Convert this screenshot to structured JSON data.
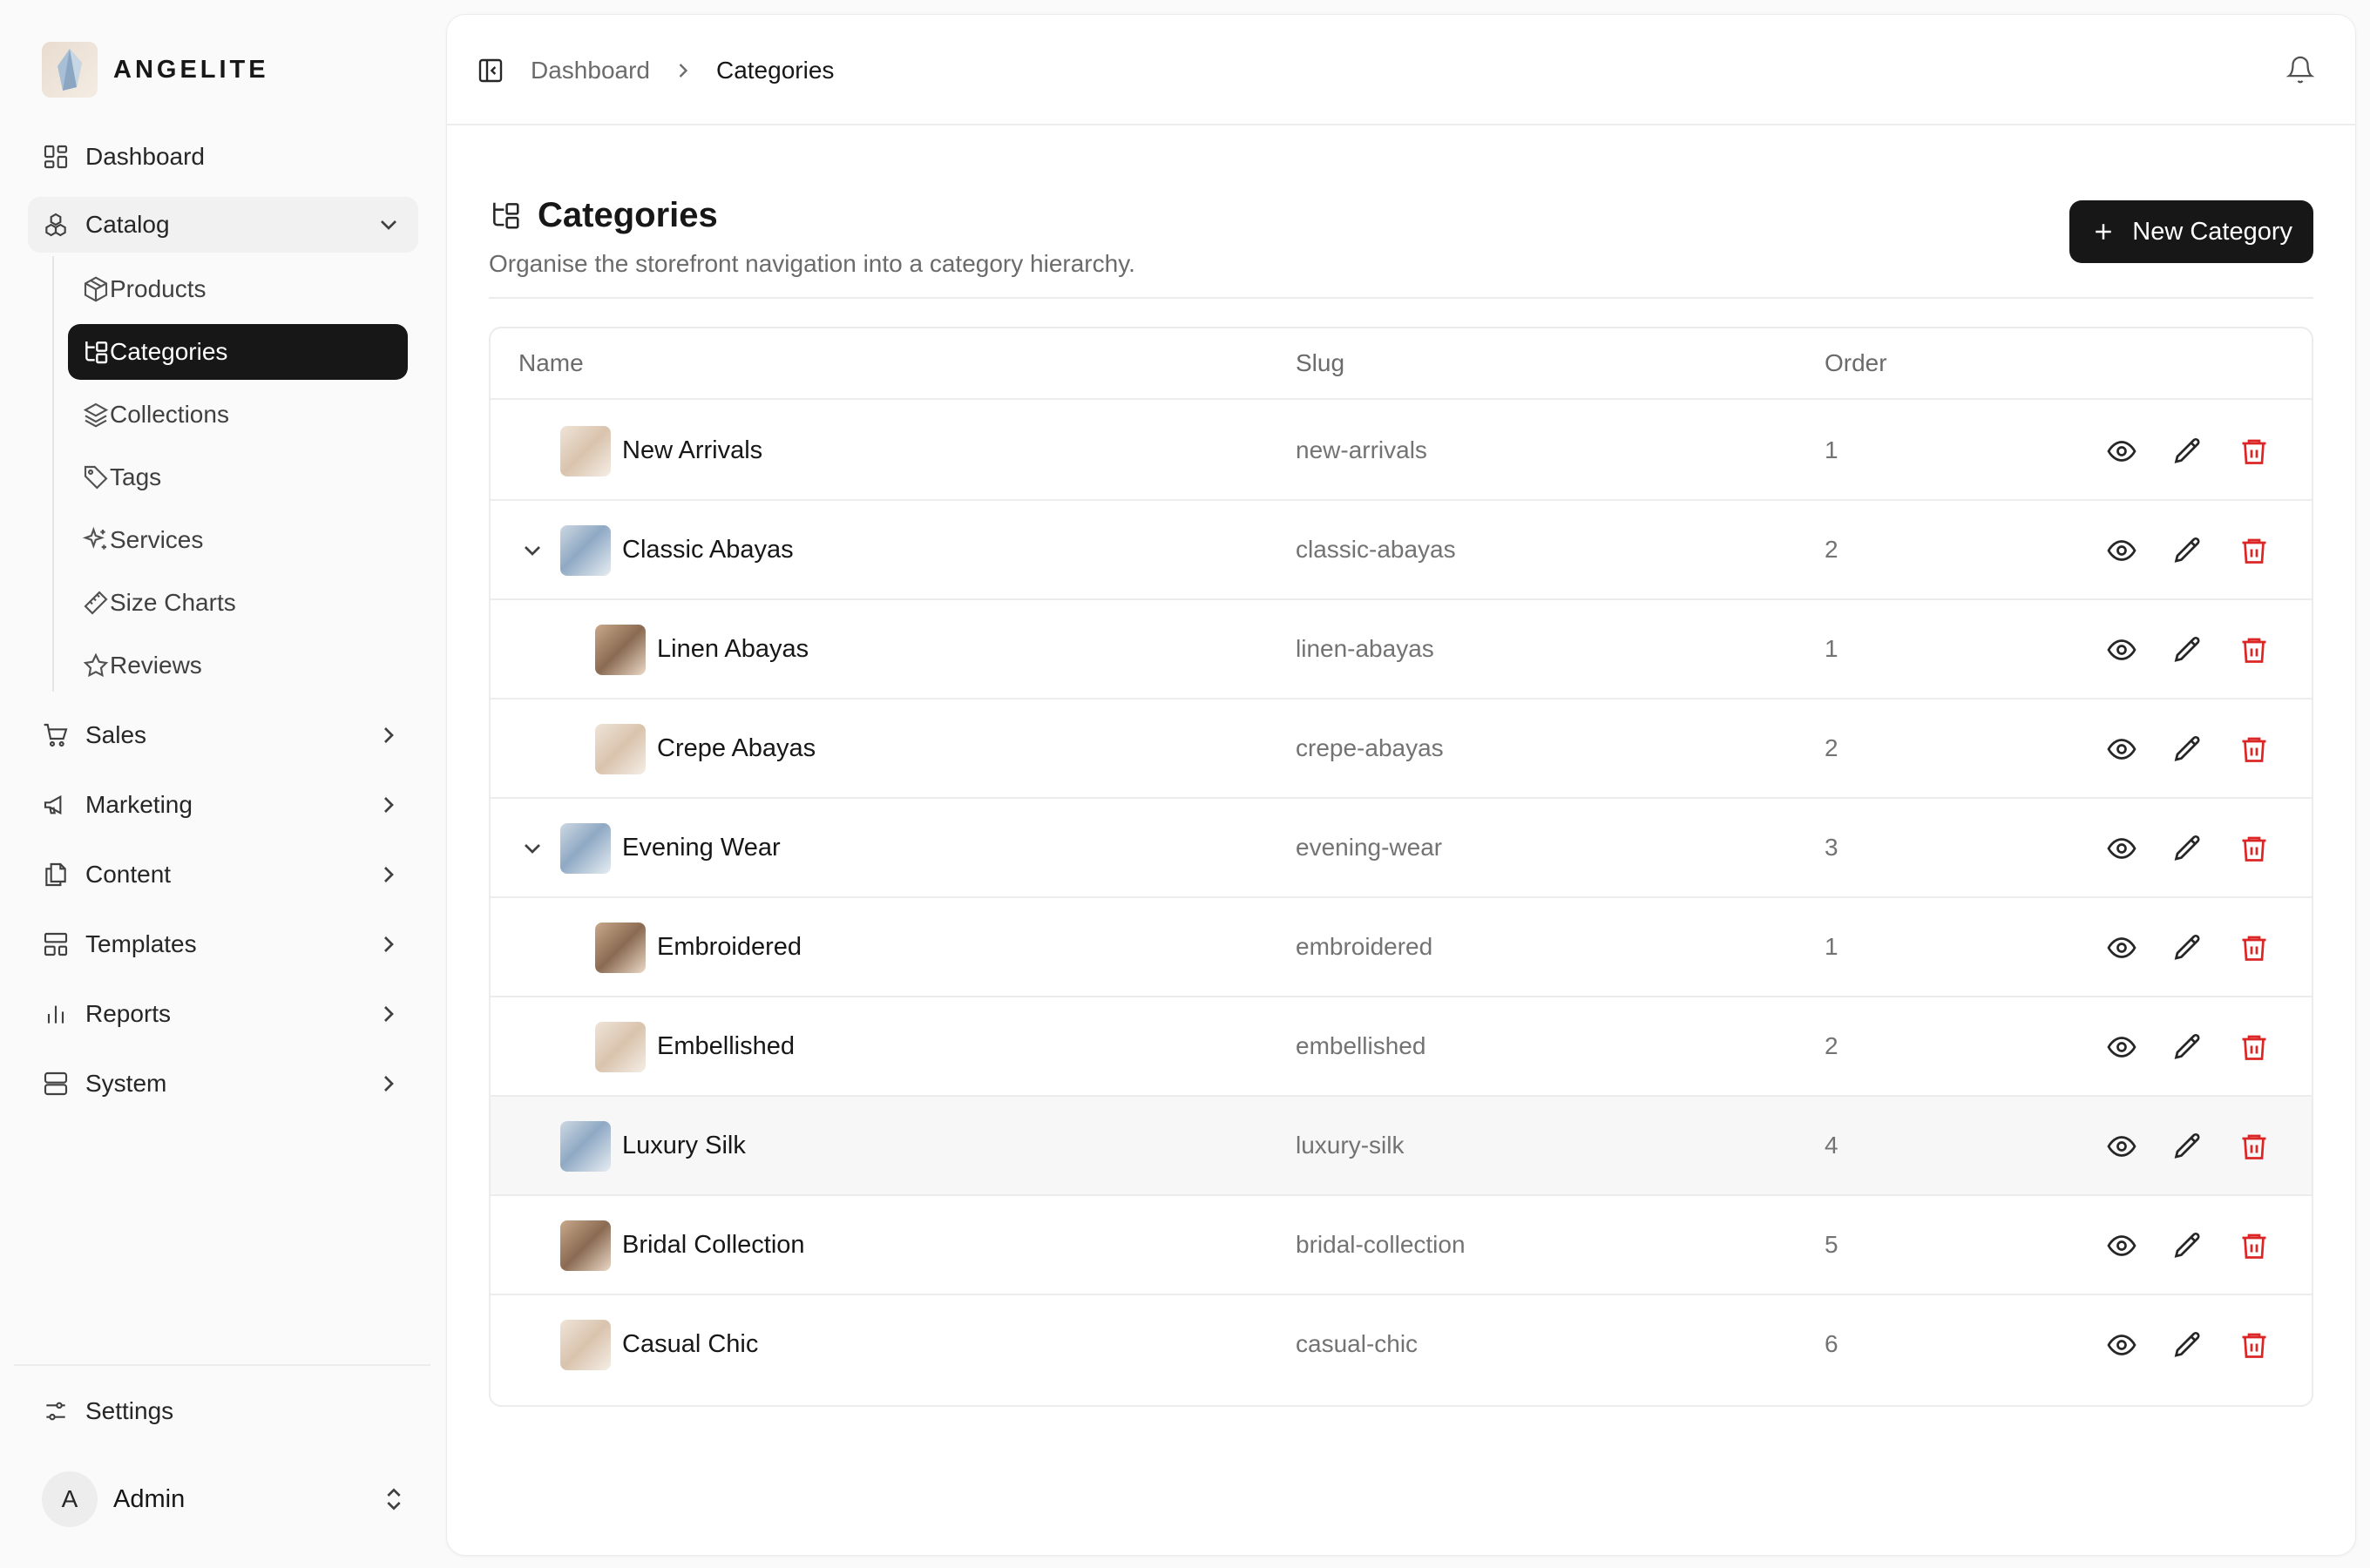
{
  "brand": {
    "name": "ANGELITE",
    "logo_icon": "crystal-logo"
  },
  "nav": {
    "dashboard": "Dashboard",
    "catalog": "Catalog",
    "catalog_items": {
      "products": "Products",
      "categories": "Categories",
      "collections": "Collections",
      "tags": "Tags",
      "services": "Services",
      "size_charts": "Size Charts",
      "reviews": "Reviews"
    },
    "sales": "Sales",
    "marketing": "Marketing",
    "content": "Content",
    "templates": "Templates",
    "reports": "Reports",
    "system": "System",
    "settings": "Settings"
  },
  "user": {
    "initial": "A",
    "name": "Admin"
  },
  "breadcrumb": {
    "parent": "Dashboard",
    "current": "Categories"
  },
  "page": {
    "title": "Categories",
    "subtitle": "Organise the storefront navigation into a category hierarchy.",
    "new_button": "New Category"
  },
  "table": {
    "columns": {
      "name": "Name",
      "slug": "Slug",
      "order": "Order"
    },
    "rows": [
      {
        "name": "New Arrivals",
        "slug": "new-arrivals",
        "order": "1",
        "level": 0,
        "expandable": false,
        "thumb": "beige"
      },
      {
        "name": "Classic Abayas",
        "slug": "classic-abayas",
        "order": "2",
        "level": 0,
        "expandable": true,
        "thumb": "blue"
      },
      {
        "name": "Linen Abayas",
        "slug": "linen-abayas",
        "order": "1",
        "level": 1,
        "expandable": false,
        "thumb": "room"
      },
      {
        "name": "Crepe Abayas",
        "slug": "crepe-abayas",
        "order": "2",
        "level": 1,
        "expandable": false,
        "thumb": "beige"
      },
      {
        "name": "Evening Wear",
        "slug": "evening-wear",
        "order": "3",
        "level": 0,
        "expandable": true,
        "thumb": "blue"
      },
      {
        "name": "Embroidered",
        "slug": "embroidered",
        "order": "1",
        "level": 1,
        "expandable": false,
        "thumb": "room"
      },
      {
        "name": "Embellished",
        "slug": "embellished",
        "order": "2",
        "level": 1,
        "expandable": false,
        "thumb": "beige"
      },
      {
        "name": "Luxury Silk",
        "slug": "luxury-silk",
        "order": "4",
        "level": 0,
        "expandable": false,
        "thumb": "blue",
        "highlighted": true
      },
      {
        "name": "Bridal Collection",
        "slug": "bridal-collection",
        "order": "5",
        "level": 0,
        "expandable": false,
        "thumb": "room"
      },
      {
        "name": "Casual Chic",
        "slug": "casual-chic",
        "order": "6",
        "level": 0,
        "expandable": false,
        "thumb": "beige"
      }
    ]
  },
  "colors": {
    "primary": "#171717",
    "danger": "#dc2626",
    "muted_text": "#737373"
  }
}
